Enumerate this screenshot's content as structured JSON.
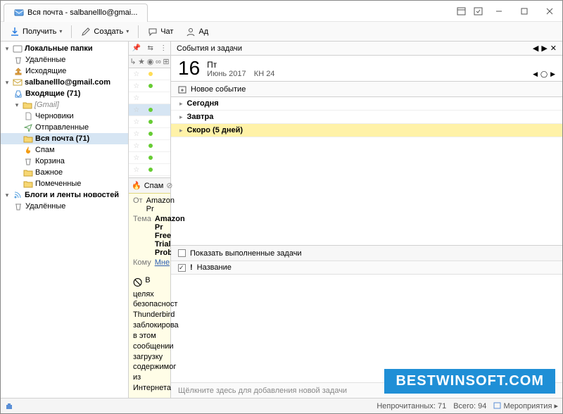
{
  "tab": {
    "title": "Вся почта - salbanelllo@gmai..."
  },
  "toolbar": {
    "receive": "Получить",
    "compose": "Создать",
    "chat": "Чат",
    "address": "Ад"
  },
  "folders": {
    "local_label": "Локальные папки",
    "local": {
      "deleted": "Удалённые",
      "outbox": "Исходящие"
    },
    "account_label": "salbanelllo@gmail.com",
    "inbox": "Входящие (71)",
    "gmail_label": "[Gmail]",
    "gmail": {
      "drafts": "Черновики",
      "sent": "Отправленные",
      "allmail": "Вся почта (71)",
      "spam": "Спам",
      "trash": "Корзина",
      "important": "Важное",
      "starred": "Помеченные"
    },
    "blogs_label": "Блоги и ленты новостей",
    "blogs_deleted": "Удалённые"
  },
  "msglist": {
    "spam_btn": "Спам",
    "from_label": "От",
    "from_value": "Amazon Pr",
    "subject_label": "Тема",
    "subject_value": "Amazon Pr\nFree Trial\nProblem",
    "to_label": "Кому",
    "to_value": "Мне",
    "body": "В целях безопасност Thunderbird заблокирова в этом сообщении загрузку содержимог из Интернета"
  },
  "calendar": {
    "panel_title": "События и задачи",
    "day_num": "16",
    "dow": "Пт",
    "month_year": "Июнь 2017",
    "week": "КН 24",
    "new_event": "Новое событие",
    "today": "Сегодня",
    "tomorrow": "Завтра",
    "soon": "Скоро (5 дней)",
    "show_completed": "Показать выполненные задачи",
    "title_col": "Название",
    "add_task_placeholder": "Щёлкните здесь для добавления новой задачи"
  },
  "status": {
    "unread": "Непрочитанных: 71",
    "total": "Всего: 94",
    "events": "Мероприятия"
  },
  "watermark": "BESTWINSOFT.COM"
}
